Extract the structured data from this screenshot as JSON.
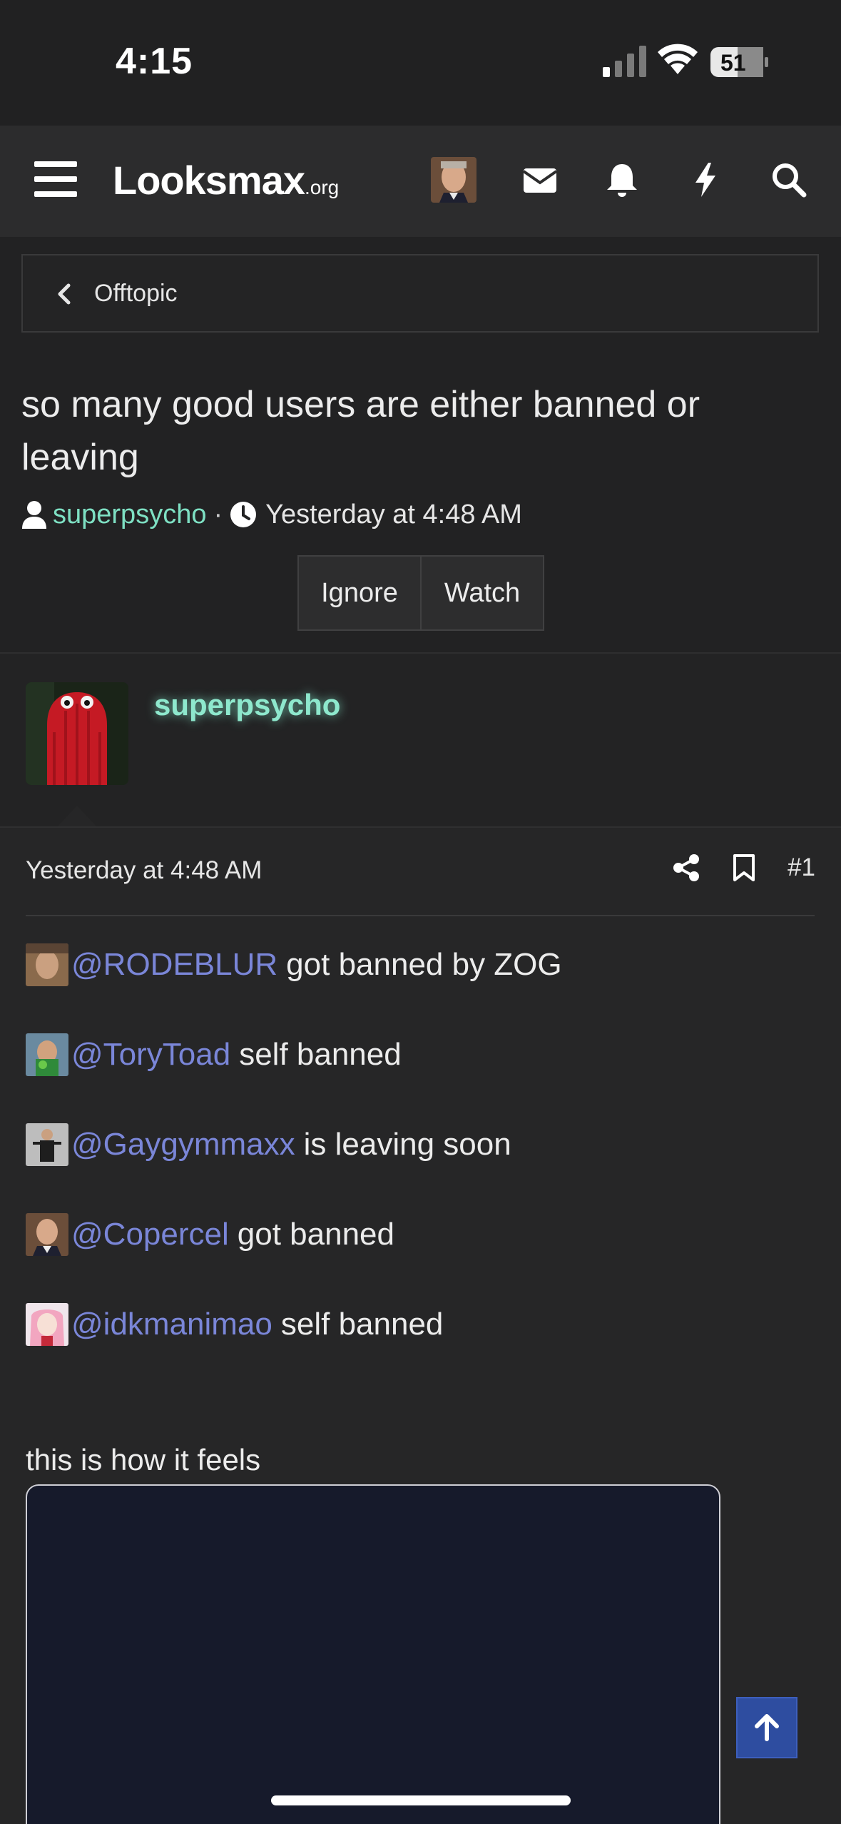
{
  "status_bar": {
    "time": "4:15",
    "battery": "51"
  },
  "nav": {
    "logo_main": "Looksmax",
    "logo_suffix": ".org",
    "icons": [
      "menu-icon",
      "mail-icon",
      "bell-icon",
      "bolt-icon",
      "search-icon"
    ]
  },
  "breadcrumb": {
    "label": "Offtopic"
  },
  "thread": {
    "title": "so many good users are either banned or leaving",
    "author": "superpsycho",
    "separator": "·",
    "date": "Yesterday at 4:48 AM",
    "ignore_label": "Ignore",
    "watch_label": "Watch"
  },
  "post": {
    "username": "superpsycho",
    "date": "Yesterday at 4:48 AM",
    "number": "#1",
    "mentions": [
      {
        "name": "@RODEBLUR",
        "text": "got banned by ZOG"
      },
      {
        "name": "@ToryToad",
        "text": "self banned"
      },
      {
        "name": "@Gaygymmaxx",
        "text": "is leaving soon"
      },
      {
        "name": "@Copercel",
        "text": "got banned"
      },
      {
        "name": "@idkmanimao",
        "text": "self banned"
      }
    ],
    "body_text": "this is how it feels"
  },
  "colors": {
    "accent_username": "#7ee0c3",
    "mention": "#7a86d8",
    "scroll_top_button": "#2e4da0"
  }
}
